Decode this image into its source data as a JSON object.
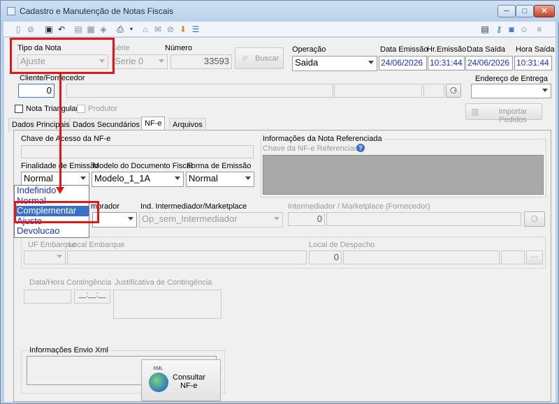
{
  "window": {
    "title": "Cadastro e Manutenção de Notas Fiscais",
    "minimize": "─",
    "maximize": "□",
    "close": "✕"
  },
  "header": {
    "tipo_nota_label": "Tipo da Nota",
    "tipo_nota_value": "Ajuste",
    "serie_label": "Série",
    "serie_value": "Serie 0",
    "numero_label": "Número",
    "numero_value": "33593",
    "buscar_label": "Buscar",
    "operacao_label": "Operação",
    "operacao_value": "Saida",
    "data_emissao_label": "Data Emissão",
    "data_emissao_value": "24/06/2026",
    "hr_emissao_label": "Hr.Emissão",
    "hr_emissao_value": "10:31:44",
    "data_saida_label": "Data Saída",
    "data_saida_value": "24/06/2026",
    "hora_saida_label": "Hora Saída",
    "hora_saida_value": "10:31:44",
    "cliente_label": "Cliente/Fornecedor",
    "cliente_value": "0",
    "endereco_label": "Endereço de Entrega",
    "nota_triangular_label": "Nota Triangular",
    "produtor_label": "Produtor",
    "importar_label": "Importar Pedidos"
  },
  "tabs": [
    "Dados Principais",
    "Dados Secundários",
    "NF-e",
    "Arquivos"
  ],
  "nfe": {
    "chave_label": "Chave de Acesso da NF-e",
    "finalidade_label": "Finalidade de Emissão",
    "finalidade_value": "Normal",
    "finalidade_options": [
      "Indefinido",
      "Normal",
      "Complementar",
      "Ajuste",
      "Devolucao"
    ],
    "modelo_label": "Modelo do Documento Fiscal",
    "modelo_value": "Modelo_1_1A",
    "forma_label": "Forma de Emissão",
    "forma_value": "Normal",
    "comprador_label": "mprador",
    "intermediador_label": "Ind. Intermediador/Marketplace",
    "intermediador_value": "Op_sem_Intermediador",
    "interm_fornec_label": "Intermediador / Marketplace (Fornecedor)",
    "interm_fornec_value": "0",
    "ref_title": "Informações da Nota Referenciada",
    "ref_chave_label": "Chave da NF-e Referenciada",
    "uf_embarque_label": "UF Embarque",
    "local_embarque_label": "Local Embarque",
    "local_despacho_label": "Local de Despacho",
    "local_despacho_value": "0",
    "contingencia_label": "Data/Hora Contingência",
    "contingencia_time": "__:__:__",
    "justificativa_label": "Justificativa de Contingência",
    "envio_xml_label": "Informações Envio Xml",
    "consultar_line1": "Consultar",
    "consultar_line2": "NF-e",
    "xml_badge": "XML"
  },
  "colors": {
    "highlight": "#e01818",
    "selection": "#3a70c8",
    "option_text": "#1a30c8"
  }
}
